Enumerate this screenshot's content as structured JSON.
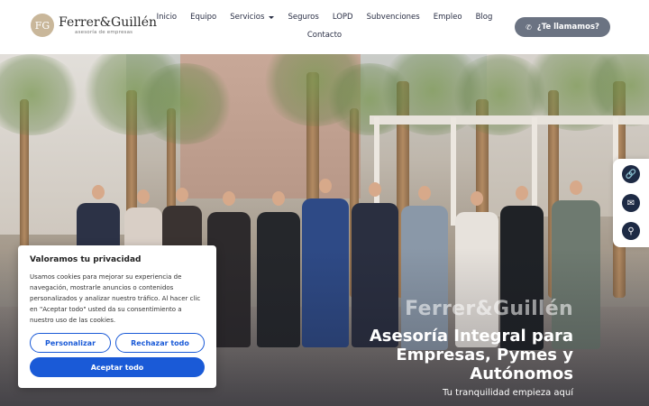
{
  "header": {
    "logo": {
      "mark": "FG",
      "name": "Ferrer&Guillén",
      "subtitle": "asesoría de empresas"
    },
    "nav": [
      {
        "label": "Inicio"
      },
      {
        "label": "Equipo"
      },
      {
        "label": "Servicios",
        "has_dropdown": true
      },
      {
        "label": "Seguros"
      },
      {
        "label": "LOPD"
      },
      {
        "label": "Subvenciones"
      },
      {
        "label": "Empleo"
      },
      {
        "label": "Blog"
      }
    ],
    "nav_second_row": [
      {
        "label": "Contacto"
      }
    ],
    "call_button": {
      "label": "¿Te llamamos?",
      "icon": "phone-icon"
    }
  },
  "hero": {
    "brand": "Ferrer&Guillén",
    "headline": "Asesoría Integral para Empresas, Pymes y Autónomos",
    "tagline": "Tu tranquilidad empieza aquí"
  },
  "side_buttons": [
    {
      "icon": "link-icon"
    },
    {
      "icon": "mail-icon"
    },
    {
      "icon": "search-icon"
    }
  ],
  "cookie_banner": {
    "title": "Valoramos tu privacidad",
    "text": "Usamos cookies para mejorar su experiencia de navegación, mostrarle anuncios o contenidos personalizados y analizar nuestro tráfico. Al hacer clic en \"Aceptar todo\" usted da su consentimiento a nuestro uso de las cookies.",
    "customize": "Personalizar",
    "reject": "Rechazar todo",
    "accept": "Aceptar todo"
  },
  "colors": {
    "accent": "#1a5ad7",
    "nav_text": "#2a2f45",
    "call_button_bg": "#6b7382",
    "side_icon_bg": "#1d2a44"
  }
}
